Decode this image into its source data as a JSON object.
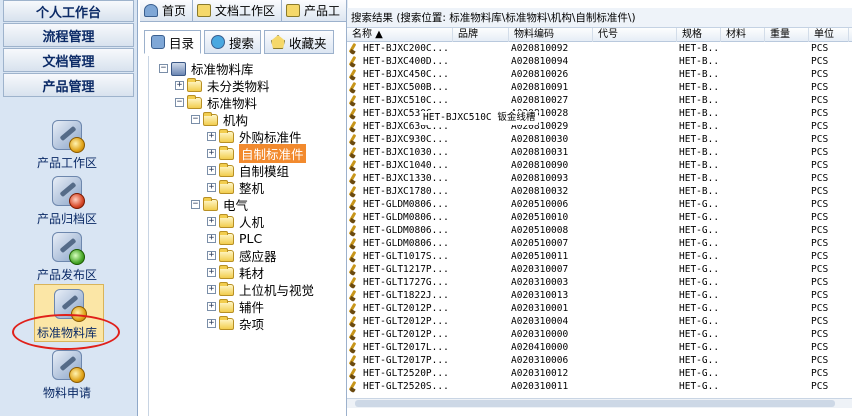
{
  "nav": {
    "headers": [
      "个人工作台",
      "流程管理",
      "文档管理",
      "产品管理"
    ],
    "launchers": [
      {
        "label": "产品工作区",
        "icon": "product-workspace-icon"
      },
      {
        "label": "产品归档区",
        "icon": "product-archive-icon"
      },
      {
        "label": "产品发布区",
        "icon": "product-release-icon"
      },
      {
        "label": "标准物料库",
        "icon": "standard-material-library-icon"
      },
      {
        "label": "物料申请",
        "icon": "material-request-icon"
      }
    ]
  },
  "tabs": [
    {
      "label": "首页",
      "icon": "home-icon"
    },
    {
      "label": "文档工作区",
      "icon": "folder-icon"
    },
    {
      "label": "产品工",
      "icon": "product-icon"
    }
  ],
  "subtabs": [
    {
      "label": "目录",
      "icon": "catalog-icon"
    },
    {
      "label": "搜索",
      "icon": "search-icon"
    },
    {
      "label": "收藏夹",
      "icon": "favorites-icon"
    }
  ],
  "tree": {
    "root": "标准物料库",
    "nodes": [
      {
        "label": "未分类物料"
      },
      {
        "label": "标准物料"
      },
      {
        "label": "机构"
      },
      {
        "label": "外购标准件"
      },
      {
        "label": "自制标准件"
      },
      {
        "label": "自制模组"
      },
      {
        "label": "整机"
      },
      {
        "label": "电气"
      },
      {
        "label": "人机"
      },
      {
        "label": "PLC"
      },
      {
        "label": "感应器"
      },
      {
        "label": "耗材"
      },
      {
        "label": "上位机与视觉"
      },
      {
        "label": "辅件"
      },
      {
        "label": "杂项"
      }
    ]
  },
  "results": {
    "breadcrumb": "搜索结果 (搜索位置: 标准物料库\\标准物料\\机构\\自制标准件\\)",
    "columns": [
      "名称 ▲",
      "品牌",
      "物料编码",
      "代号",
      "规格",
      "材料",
      "重量",
      "单位"
    ],
    "rows": [
      [
        "HET-BJXC200C...",
        "",
        "A020810092",
        "",
        "HET-B...",
        "",
        "",
        "PCS"
      ],
      [
        "HET-BJXC400D...",
        "",
        "A020810094",
        "",
        "HET-B...",
        "",
        "",
        "PCS"
      ],
      [
        "HET-BJXC450C...",
        "",
        "A020810026",
        "",
        "HET-B...",
        "",
        "",
        "PCS"
      ],
      [
        "HET-BJXC500B...",
        "",
        "A020810091",
        "",
        "HET-B...",
        "",
        "",
        "PCS"
      ],
      [
        "HET-BJXC510C...",
        "",
        "A020810027",
        "",
        "HET-B...",
        "",
        "",
        "PCS"
      ],
      [
        "HET-BJXC530C...",
        "",
        "A020810028",
        "",
        "HET-B...",
        "",
        "",
        "PCS"
      ],
      [
        "HET-BJXC630C...",
        "",
        "A020810029",
        "",
        "HET-B...",
        "",
        "",
        "PCS"
      ],
      [
        "HET-BJXC930C...",
        "",
        "A020810030",
        "",
        "HET-B...",
        "",
        "",
        "PCS"
      ],
      [
        "HET-BJXC1030...",
        "",
        "A020810031",
        "",
        "HET-B...",
        "",
        "",
        "PCS"
      ],
      [
        "HET-BJXC1040...",
        "",
        "A020810090",
        "",
        "HET-B...",
        "",
        "",
        "PCS"
      ],
      [
        "HET-BJXC1330...",
        "",
        "A020810093",
        "",
        "HET-B...",
        "",
        "",
        "PCS"
      ],
      [
        "HET-BJXC1780...",
        "",
        "A020810032",
        "",
        "HET-B...",
        "",
        "",
        "PCS"
      ],
      [
        "HET-GLDM0806...",
        "",
        "A020510006",
        "",
        "HET-G...",
        "",
        "",
        "PCS"
      ],
      [
        "HET-GLDM0806...",
        "",
        "A020510010",
        "",
        "HET-G...",
        "",
        "",
        "PCS"
      ],
      [
        "HET-GLDM0806...",
        "",
        "A020510008",
        "",
        "HET-G...",
        "",
        "",
        "PCS"
      ],
      [
        "HET-GLDM0806...",
        "",
        "A020510007",
        "",
        "HET-G...",
        "",
        "",
        "PCS"
      ],
      [
        "HET-GLT1017S...",
        "",
        "A020510011",
        "",
        "HET-G...",
        "",
        "",
        "PCS"
      ],
      [
        "HET-GLT1217P...",
        "",
        "A020310007",
        "",
        "HET-G...",
        "",
        "",
        "PCS"
      ],
      [
        "HET-GLT1727G...",
        "",
        "A020310003",
        "",
        "HET-G...",
        "",
        "",
        "PCS"
      ],
      [
        "HET-GLT1822J...",
        "",
        "A020310013",
        "",
        "HET-G...",
        "",
        "",
        "PCS"
      ],
      [
        "HET-GLT2012P...",
        "",
        "A020310001",
        "",
        "HET-G...",
        "",
        "",
        "PCS"
      ],
      [
        "HET-GLT2012P...",
        "",
        "A020310004",
        "",
        "HET-G...",
        "",
        "",
        "PCS"
      ],
      [
        "HET-GLT2012P...",
        "",
        "A020310000",
        "",
        "HET-G...",
        "",
        "",
        "PCS"
      ],
      [
        "HET-GLT2017L...",
        "",
        "A020410000",
        "",
        "HET-G...",
        "",
        "",
        "PCS"
      ],
      [
        "HET-GLT2017P...",
        "",
        "A020310006",
        "",
        "HET-G...",
        "",
        "",
        "PCS"
      ],
      [
        "HET-GLT2520P...",
        "",
        "A020310012",
        "",
        "HET-G...",
        "",
        "",
        "PCS"
      ],
      [
        "HET-GLT2520S...",
        "",
        "A020310011",
        "",
        "HET-G...",
        "",
        "",
        "PCS"
      ]
    ],
    "tooltip": "HET-BJXC510C 钣金线槽"
  },
  "colors": {
    "selected_tree": "#f28a2e",
    "annotation": "#e0201a",
    "nav_bg": "#d9e5f3"
  }
}
